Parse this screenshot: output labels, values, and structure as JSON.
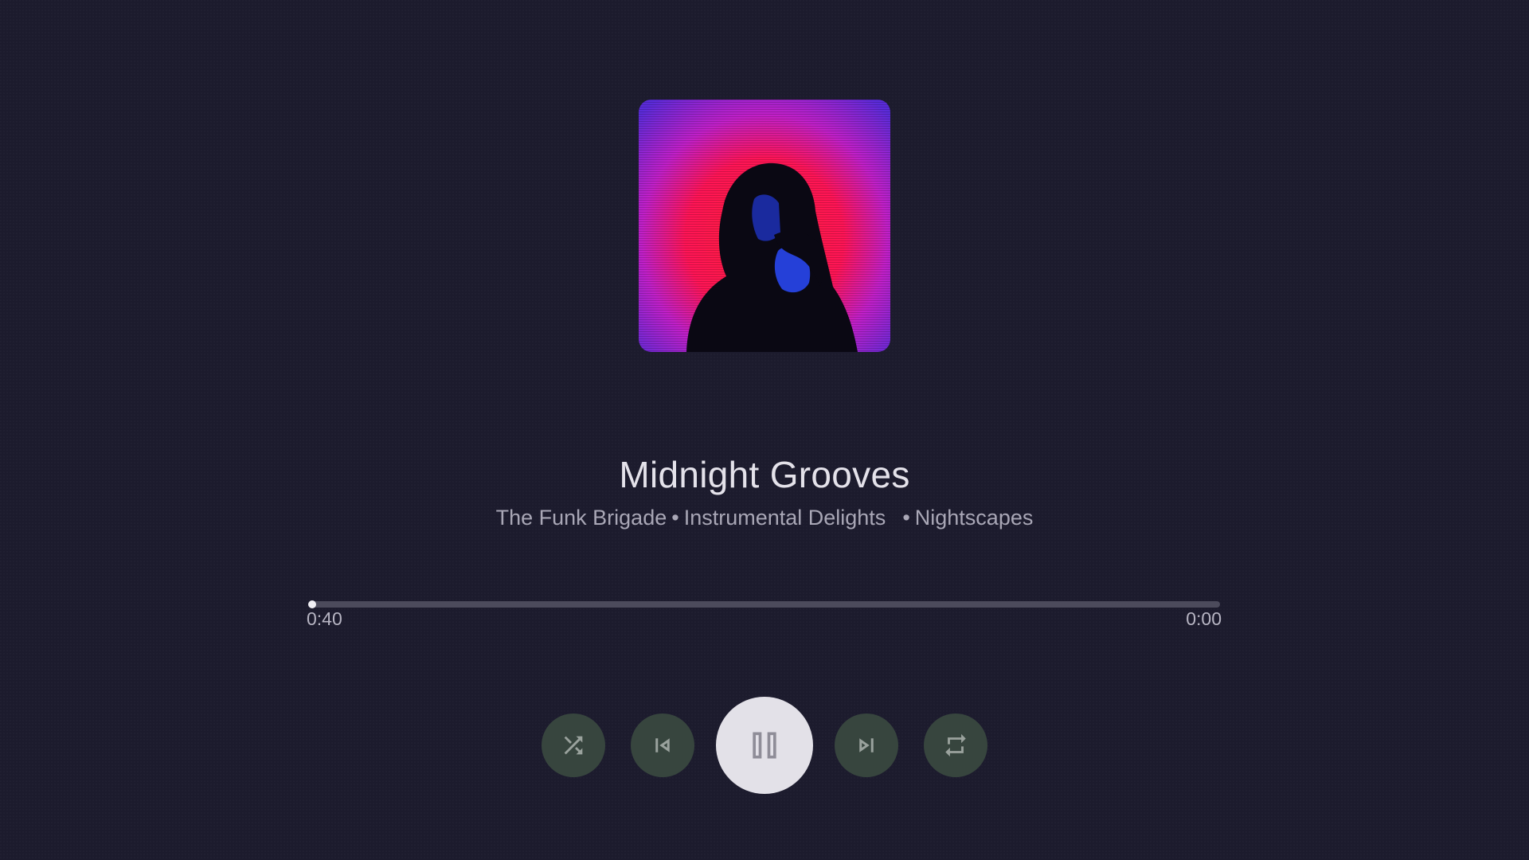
{
  "track": {
    "title": "Midnight Grooves",
    "artist": "The Funk Brigade",
    "album": "Instrumental Delights",
    "playlist": "Nightscapes",
    "separator": "•"
  },
  "playback": {
    "elapsed": "0:40",
    "total": "0:00",
    "progress_fraction": 0.0,
    "state": "playing"
  },
  "controls": {
    "shuffle_icon": "shuffle-icon",
    "previous_icon": "skip-previous-icon",
    "play_pause_icon": "pause-icon",
    "next_icon": "skip-next-icon",
    "repeat_icon": "repeat-icon"
  },
  "colors": {
    "background": "#1c1b2d",
    "control_bg": "#37453e",
    "play_bg": "#e3e1e8",
    "icon_color": "#9aa29d"
  }
}
